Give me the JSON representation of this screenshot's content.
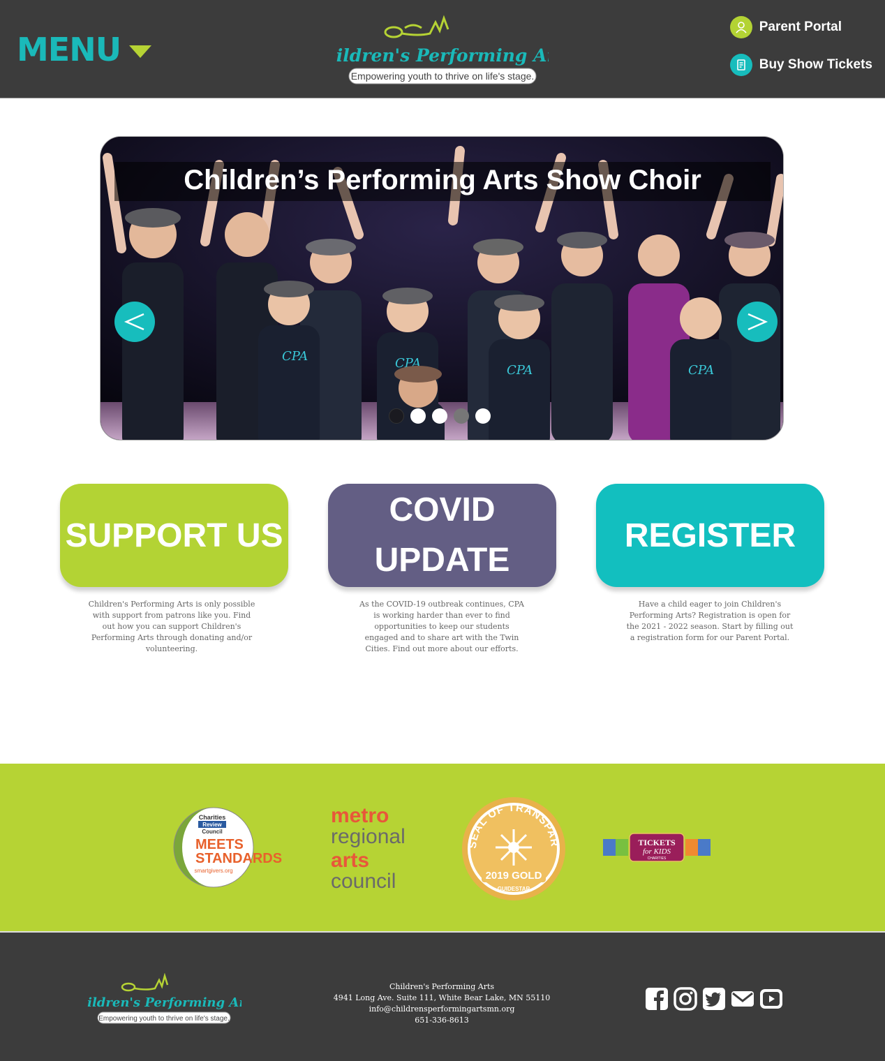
{
  "header": {
    "menu_label": "MENU",
    "logo_text": "Children's Performing Arts",
    "logo_tagline": "Empowering youth to thrive on life's stage.",
    "links": [
      {
        "label": "Parent Portal",
        "icon": "person-icon",
        "color": "#b3d334"
      },
      {
        "label": "Buy Show Tickets",
        "icon": "ticket-icon",
        "color": "#17bdbd"
      }
    ]
  },
  "slider": {
    "title": "Children’s Performing Arts Show Choir",
    "prev_symbol": "<",
    "next_symbol": ">",
    "dot_count": 5,
    "active_dot": 3
  },
  "cards": [
    {
      "title": "SUPPORT US",
      "color": "#b3d334",
      "text": "Children's Performing Arts is only possible with support from patrons like you. Find out how you can support Children's Performing Arts through donating and/or volunteering."
    },
    {
      "title": "COVID UPDATE",
      "color": "#635e84",
      "text": "As the COVID-19 outbreak continues, CPA is working harder than ever to find opportunities to keep our students engaged and to share art with the Twin Cities. Find out more about our efforts."
    },
    {
      "title": "REGISTER",
      "color": "#12bfbf",
      "text": "Have a child eager to join Children's Performing Arts? Registration is open for the 2021 - 2022 season. Start by filling out a registration form for our Parent Portal."
    }
  ],
  "partners": {
    "charities": {
      "line1": "Charities",
      "line2": "Review",
      "line3": "Council",
      "big1": "MEETS",
      "big2": "STANDARDS",
      "small": "smartgivers.org"
    },
    "metro": {
      "w1": "metro",
      "w2": "regional",
      "w3": "arts",
      "w4": "council"
    },
    "guidestar": {
      "arc": "SEAL OF TRANSPARENCY",
      "level": "2019 GOLD",
      "brand": "GUIDESTAR"
    },
    "tickets": {
      "w1": "TICKETS",
      "w2": "for KIDS",
      "w3": "CHARITIES"
    }
  },
  "footer": {
    "org": "Children's Performing Arts",
    "address": "4941 Long Ave. Suite 111, White Bear Lake, MN 55110",
    "email": "info@childrensperformingartsmn.org",
    "phone": "651-336-8613",
    "social": [
      "facebook-icon",
      "instagram-icon",
      "twitter-icon",
      "email-icon",
      "youtube-icon"
    ]
  },
  "colors": {
    "lime": "#b3d334",
    "teal": "#17bdbd",
    "purple": "#635e84",
    "dark": "#3c3c3c"
  }
}
